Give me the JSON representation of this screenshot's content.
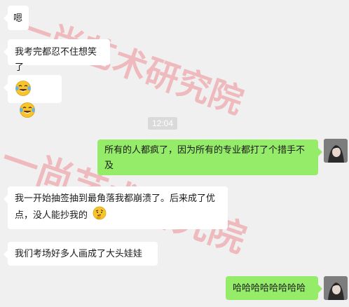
{
  "messages": [
    {
      "sender": "other",
      "text": "嗯"
    },
    {
      "sender": "other",
      "text": "我考完都忍不住想笑了"
    },
    {
      "sender": "other",
      "emoji": [
        "laughing-tears-emoji",
        "laughing-tears-emoji"
      ]
    },
    {
      "sender": "self",
      "text": "所有的人都疯了，因为所有的专业都打了个措手不及"
    },
    {
      "sender": "other",
      "text": "我一开始抽签抽到最角落我都崩溃了。后来成了优点，没人能抄我的",
      "emoji": "thinking-face-emoji"
    },
    {
      "sender": "other",
      "text": "我们考场好多人画成了大头娃娃"
    },
    {
      "sender": "self",
      "text": "哈哈哈哈哈哈哈哈"
    }
  ],
  "timestamp": "12:04",
  "watermark": "一尚艺术研究院",
  "colors": {
    "background": "#f0f0f0",
    "incoming_bubble": "#ffffff",
    "outgoing_bubble": "#95ec69",
    "watermark": "#ec6068"
  }
}
